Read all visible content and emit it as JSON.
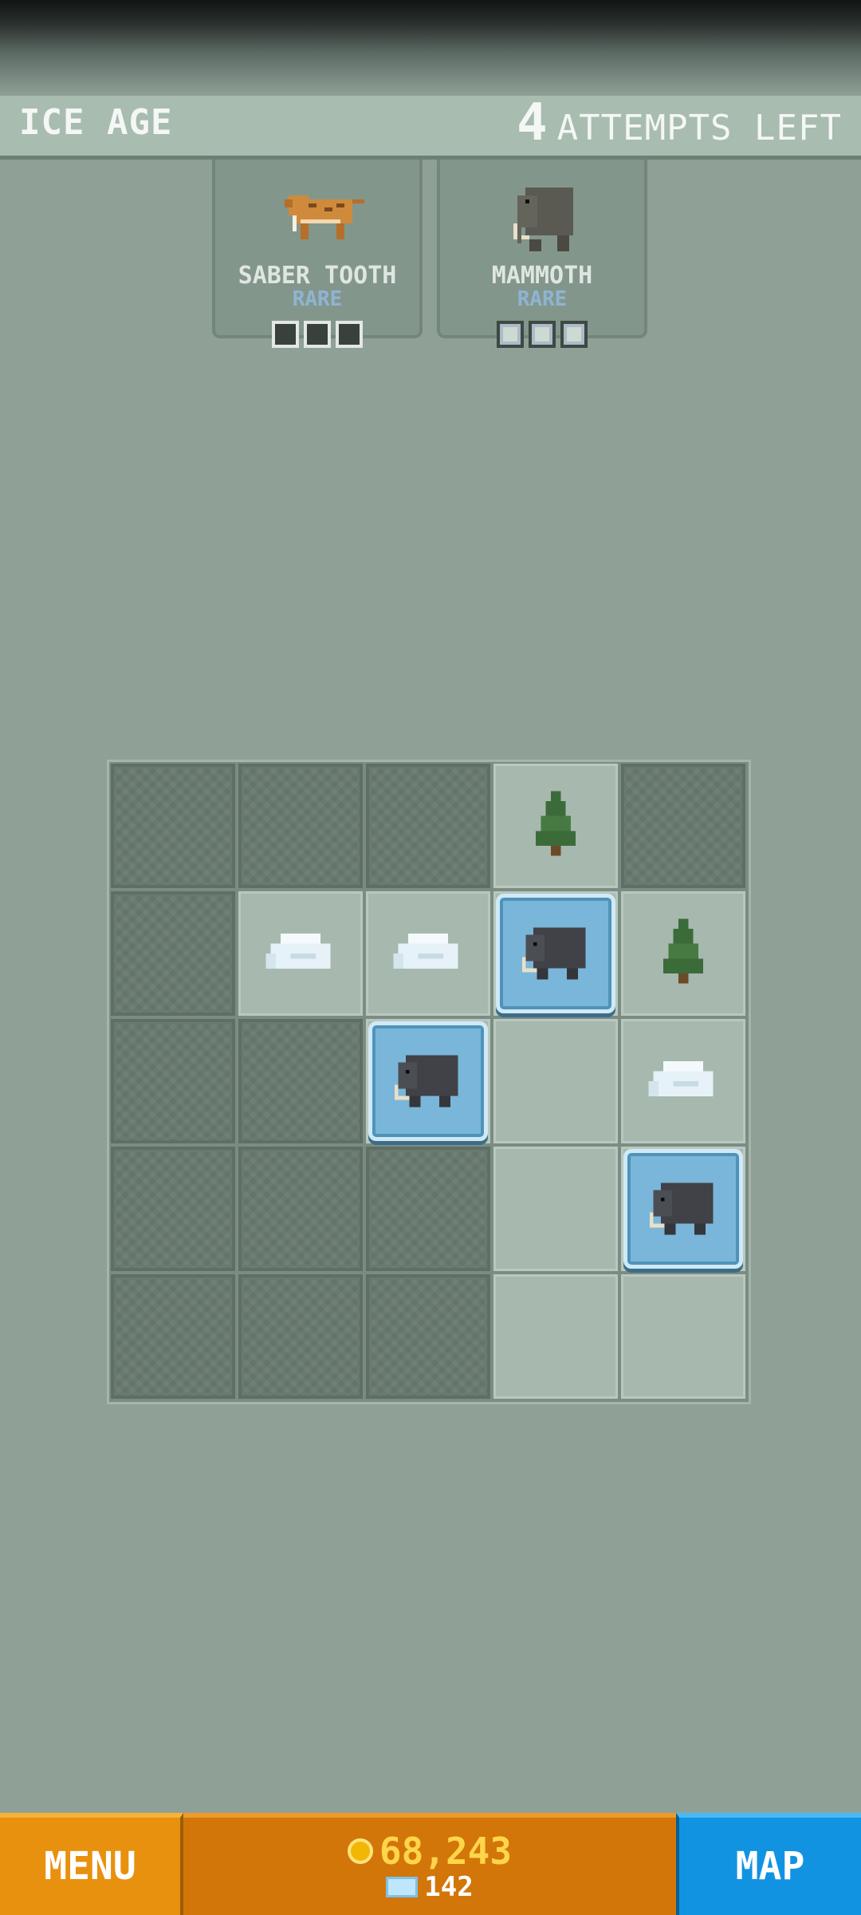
{
  "header": {
    "title": "ICE AGE",
    "attempts_count": "4",
    "attempts_label": "ATTEMPTS LEFT"
  },
  "cards": [
    {
      "name": "SABER TOOTH",
      "rarity": "RARE",
      "found": 0,
      "total": 3,
      "icon": "saber-tooth-icon"
    },
    {
      "name": "MAMMOTH",
      "rarity": "RARE",
      "found": 3,
      "total": 3,
      "icon": "mammoth-icon"
    }
  ],
  "board": {
    "rows": [
      [
        "covered",
        "covered",
        "covered",
        "tree",
        "covered"
      ],
      [
        "covered",
        "ice",
        "ice",
        "mammoth",
        "tree"
      ],
      [
        "covered",
        "covered",
        "mammoth",
        "empty",
        "ice"
      ],
      [
        "covered",
        "covered",
        "covered",
        "empty",
        "mammoth"
      ],
      [
        "covered",
        "covered",
        "covered",
        "empty",
        "empty"
      ]
    ]
  },
  "footer": {
    "menu_label": "MENU",
    "gold": "68,243",
    "gems": "142",
    "map_label": "MAP"
  },
  "colors": {
    "menu": "#e8910f",
    "currency": "#d2760a",
    "map": "#1193e2",
    "gold_text": "#ffd54a",
    "rare": "#8fb4d3"
  }
}
